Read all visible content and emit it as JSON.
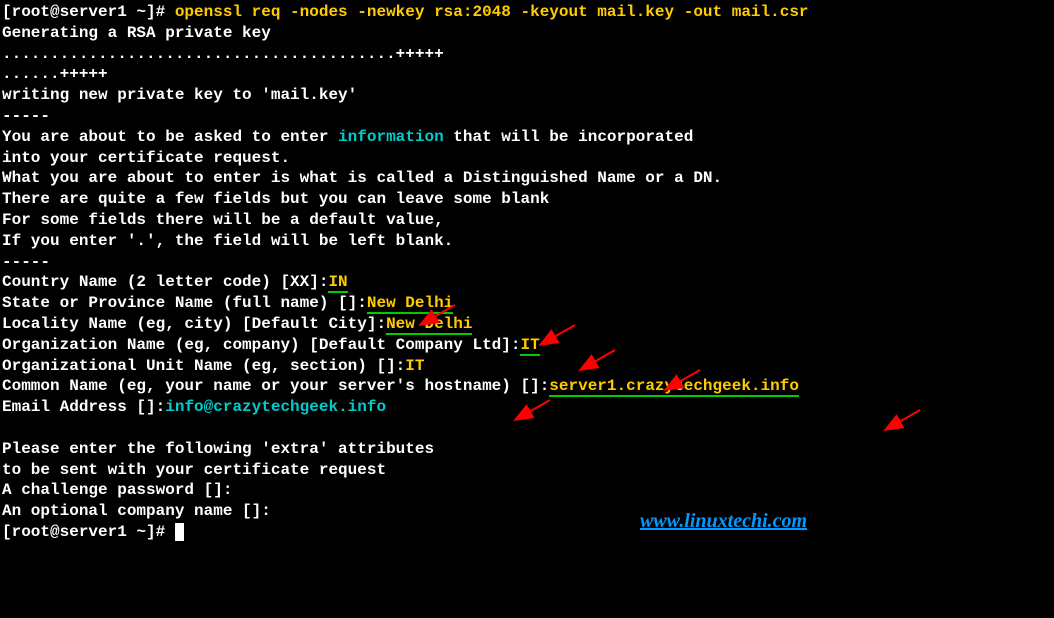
{
  "prompt1": {
    "user_host": "[root@server1 ~]# ",
    "command": "openssl req -nodes -newkey rsa:2048 -keyout mail.key -out mail.csr"
  },
  "lines": {
    "gen": "Generating a RSA private key",
    "dots1": ".........................................+++++",
    "dots2": "......+++++",
    "writing": "writing new private key to 'mail.key'",
    "dash1": "-----",
    "about1a": "You are about to be asked to enter ",
    "about1b": "information",
    "about1c": " that will be incorporated",
    "about2": "into your certificate request.",
    "about3": "What you are about to enter is what is called a Distinguished Name or a DN.",
    "about4": "There are quite a few fields but you can leave some blank",
    "about5": "For some fields there will be a default value,",
    "about6": "If you enter '.', the field will be left blank.",
    "dash2": "-----",
    "country_prompt": "Country Name (2 letter code) [XX]:",
    "country_value": "IN",
    "state_prompt": "State or Province Name (full name) []:",
    "state_value": "New Delhi",
    "locality_prompt": "Locality Name (eg, city) [Default City]:",
    "locality_value": "New Delhi",
    "org_prompt": "Organization Name (eg, company) [Default Company Ltd]:",
    "org_value": "IT",
    "ou_prompt": "Organizational Unit Name (eg, section) []:",
    "ou_value": "IT",
    "cn_prompt": "Common Name (eg, your name or your server's hostname) []:",
    "cn_value": "server1.crazytechgeek.info",
    "email_prompt": "Email Address []:",
    "email_value": "info@crazytechgeek.info",
    "extra1": "Please enter the following 'extra' attributes",
    "extra2": "to be sent with your certificate request",
    "challenge": "A challenge password []:",
    "optcompany": "An optional company name []:"
  },
  "prompt2": {
    "user_host": "[root@server1 ~]# "
  },
  "watermark": "www.linuxtechi.com"
}
